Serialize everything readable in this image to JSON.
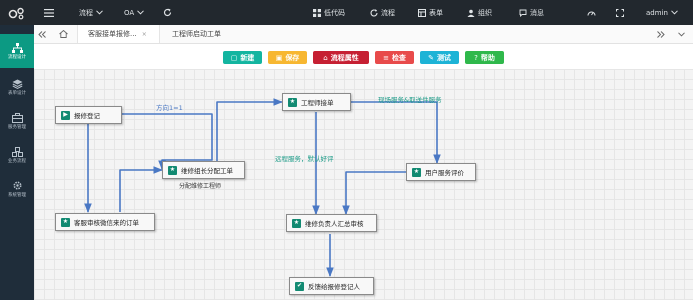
{
  "topbar": {
    "menu_process": "流程",
    "menu_oa": "OA",
    "nav_lowcode": "低代码",
    "nav_workflow": "流程",
    "nav_form": "表单",
    "nav_org": "组织",
    "nav_message": "消息",
    "user": "admin"
  },
  "sidebar": {
    "items": [
      {
        "label": "流程设计",
        "icon": "sitemap-icon"
      },
      {
        "label": "表单设计",
        "icon": "layers-icon"
      },
      {
        "label": "服务管理",
        "icon": "briefcase-icon"
      },
      {
        "label": "业务流程",
        "icon": "cubes-icon"
      },
      {
        "label": "系统管理",
        "icon": "gear-icon"
      }
    ]
  },
  "tabs": [
    {
      "label": "客服接单报修...",
      "active": true
    },
    {
      "label": "工程师启动工单",
      "active": false
    }
  ],
  "toolbar": {
    "new_label": "新建",
    "save_label": "保存",
    "props_label": "流程属性",
    "check_label": "检查",
    "test_label": "测试",
    "help_label": "帮助",
    "colors": {
      "new": "#13b5a0",
      "save": "#f7b731",
      "props": "#c62033",
      "check": "#e84b4b",
      "test": "#1db3d6",
      "help": "#2fb84b"
    }
  },
  "flow": {
    "nodes": {
      "start": "报修登记",
      "dispatch": "维修组长分配工单",
      "review": "客服审核微信来的订单",
      "engineer": "工程师接单",
      "evaluate": "用户服务评价",
      "summary": "维修负责人汇总审核",
      "feedback": "反馈给报修登记人"
    },
    "edge_labels": {
      "direction": "方向1=1",
      "assign": "分配维修工程师",
      "onsite": "现场服务&取送件服务",
      "remote": "远程服务，默认好评"
    },
    "colors": {
      "edge": "#4a78c4",
      "edge_label": "#1a9a86",
      "node_icon": "#128a72"
    }
  }
}
